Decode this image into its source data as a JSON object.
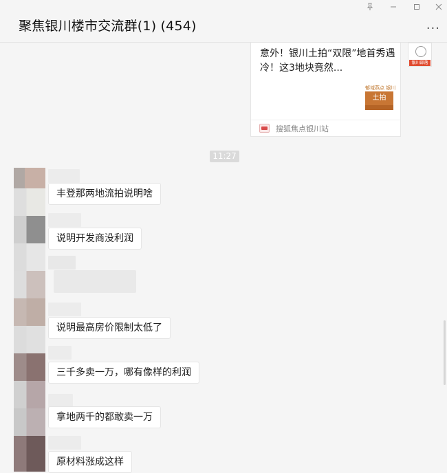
{
  "window": {
    "title": "聚焦银川楼市交流群(1) (454)",
    "more_label": "···"
  },
  "link_card": {
    "title": "意外！银川土拍“双限”地首秀遇冷！这3地块竟然...",
    "thumb_top": "郁域燕点 银川",
    "thumb_label": "土拍",
    "source": "搜狐焦点银川站"
  },
  "sender_avatar_tag": "银川部落",
  "timestamp": "11:27",
  "messages": [
    {
      "text": "丰登那两地流拍说明啥"
    },
    {
      "text": "说明开发商没利润"
    },
    {
      "text": "说明最高房价限制太低了"
    },
    {
      "text": "三千多卖一万，哪有像样的利润"
    },
    {
      "text": "拿地两千的都敢卖一万"
    },
    {
      "text": "原材料涨成这样"
    }
  ],
  "colors": {
    "background": "#f5f5f5",
    "bubble": "#ffffff",
    "timestamp_bg": "#dadada"
  }
}
